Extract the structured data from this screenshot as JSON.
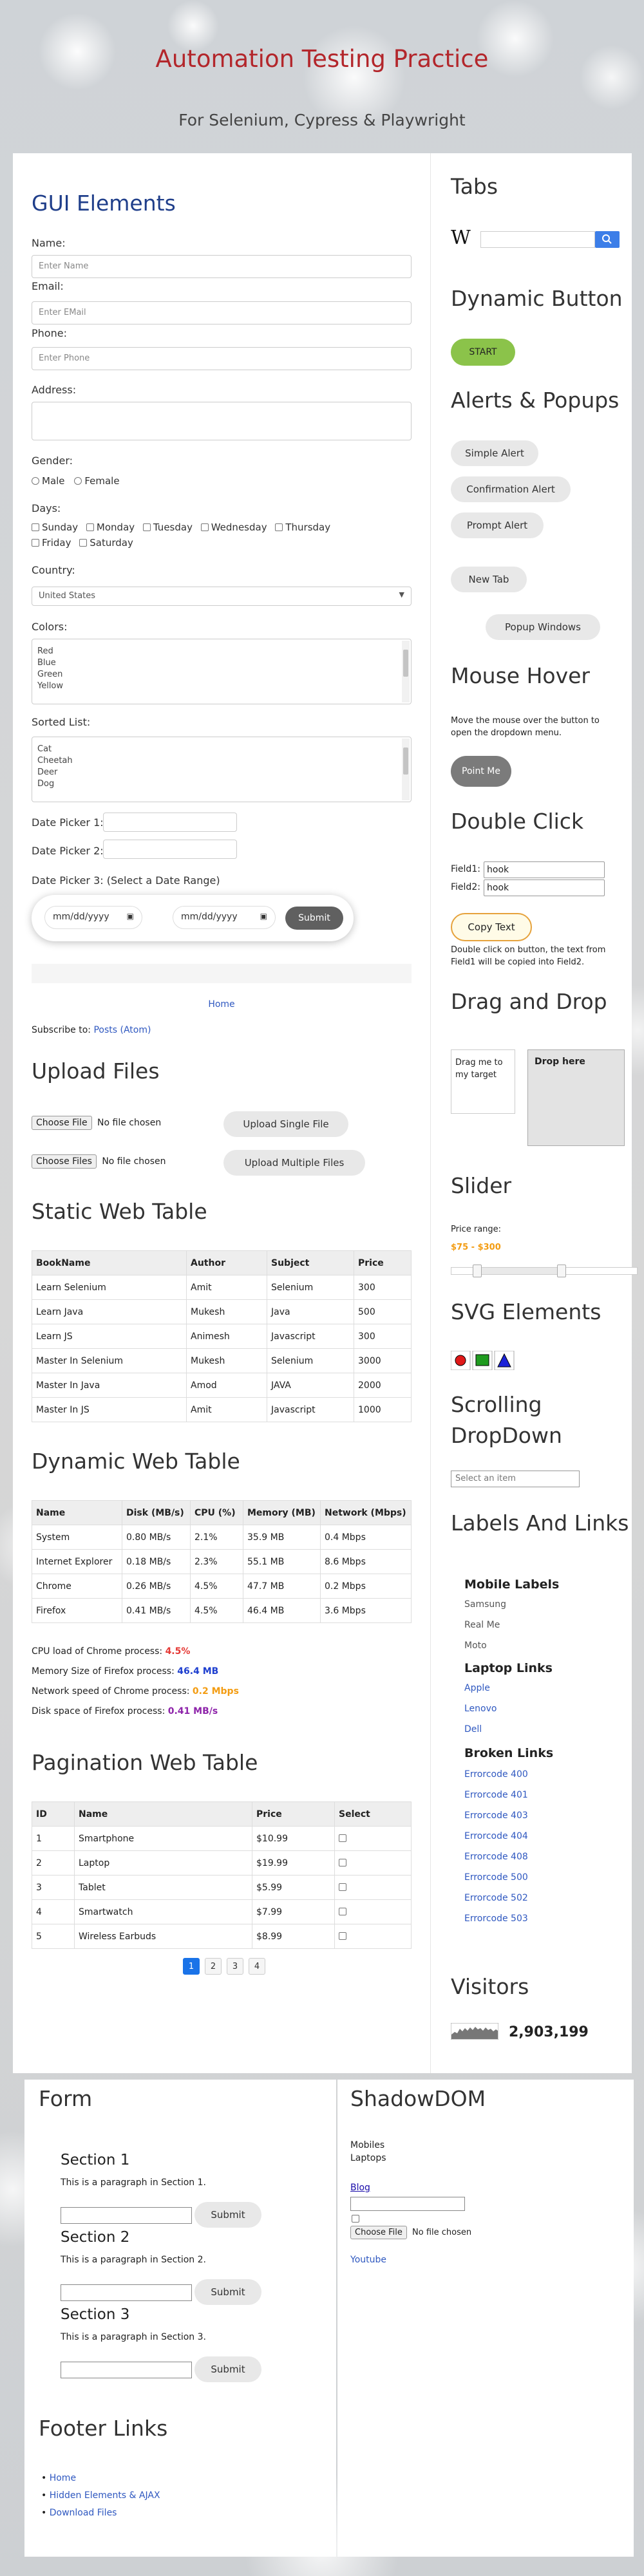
{
  "header": {
    "title": "Automation Testing Practice",
    "subtitle": "For Selenium, Cypress & Playwright"
  },
  "gui": {
    "title": "GUI Elements",
    "name_label": "Name:",
    "name_placeholder": "Enter Name",
    "email_label": "Email:",
    "email_placeholder": "Enter EMail",
    "phone_label": "Phone:",
    "phone_placeholder": "Enter Phone",
    "address_label": "Address:",
    "gender_label": "Gender:",
    "gender_options": [
      "Male",
      "Female"
    ],
    "days_label": "Days:",
    "days": [
      "Sunday",
      "Monday",
      "Tuesday",
      "Wednesday",
      "Thursday",
      "Friday",
      "Saturday"
    ],
    "country_label": "Country:",
    "country_value": "United States",
    "colors_label": "Colors:",
    "colors": [
      "Red",
      "Blue",
      "Green",
      "Yellow"
    ],
    "sorted_label": "Sorted List:",
    "sorted": [
      "Cat",
      "Cheetah",
      "Deer",
      "Dog"
    ],
    "dp1_label": "Date Picker 1:",
    "dp2_label": "Date Picker 2:",
    "dp3_label": "Date Picker 3: (Select a Date Range)",
    "date_placeholder": "mm/dd/yyyy",
    "submit": "Submit"
  },
  "blog": {
    "home": "Home",
    "subscribe_prefix": "Subscribe to: ",
    "subscribe_link": "Posts (Atom)"
  },
  "upload": {
    "title": "Upload Files",
    "choose_file": "Choose File",
    "choose_files": "Choose Files",
    "no_file": "No file chosen",
    "single_btn": "Upload Single File",
    "multi_btn": "Upload Multiple Files"
  },
  "static_table": {
    "title": "Static Web Table",
    "headers": [
      "BookName",
      "Author",
      "Subject",
      "Price"
    ],
    "rows": [
      [
        "Learn Selenium",
        "Amit",
        "Selenium",
        "300"
      ],
      [
        "Learn Java",
        "Mukesh",
        "Java",
        "500"
      ],
      [
        "Learn JS",
        "Animesh",
        "Javascript",
        "300"
      ],
      [
        "Master In Selenium",
        "Mukesh",
        "Selenium",
        "3000"
      ],
      [
        "Master In Java",
        "Amod",
        "JAVA",
        "2000"
      ],
      [
        "Master In JS",
        "Amit",
        "Javascript",
        "1000"
      ]
    ]
  },
  "dynamic_table": {
    "title": "Dynamic Web Table",
    "headers": [
      "Name",
      "Disk (MB/s)",
      "CPU (%)",
      "Memory (MB)",
      "Network (Mbps)"
    ],
    "rows": [
      [
        "System",
        "0.80 MB/s",
        "2.1%",
        "35.9 MB",
        "0.4 Mbps"
      ],
      [
        "Internet Explorer",
        "0.18 MB/s",
        "2.3%",
        "55.1 MB",
        "8.6 Mbps"
      ],
      [
        "Chrome",
        "0.26 MB/s",
        "4.5%",
        "47.7 MB",
        "0.2 Mbps"
      ],
      [
        "Firefox",
        "0.41 MB/s",
        "4.5%",
        "46.4 MB",
        "3.6 Mbps"
      ]
    ],
    "stats": [
      {
        "label": "CPU load of Chrome process: ",
        "value": "4.5%",
        "color": "#e53935"
      },
      {
        "label": "Memory Size of Firefox process: ",
        "value": "46.4 MB",
        "color": "#1e3fcf"
      },
      {
        "label": "Network speed of Chrome process: ",
        "value": "0.2 Mbps",
        "color": "#f39c12"
      },
      {
        "label": "Disk space of Firefox process: ",
        "value": "0.41 MB/s",
        "color": "#8e24aa"
      }
    ]
  },
  "pagination": {
    "title": "Pagination Web Table",
    "headers": [
      "ID",
      "Name",
      "Price",
      "Select"
    ],
    "rows": [
      [
        "1",
        "Smartphone",
        "$10.99"
      ],
      [
        "2",
        "Laptop",
        "$19.99"
      ],
      [
        "3",
        "Tablet",
        "$5.99"
      ],
      [
        "4",
        "Smartwatch",
        "$7.99"
      ],
      [
        "5",
        "Wireless Earbuds",
        "$8.99"
      ]
    ],
    "pages": [
      "1",
      "2",
      "3",
      "4"
    ],
    "active_page": "1"
  },
  "tabs": {
    "title": "Tabs",
    "wiki_logo": "W",
    "search_icon": "search-icon"
  },
  "dynamic_button": {
    "title": "Dynamic Button",
    "start": "START",
    "color": "#8bc34a"
  },
  "alerts": {
    "title": "Alerts & Popups",
    "simple": "Simple Alert",
    "confirm": "Confirmation Alert",
    "prompt": "Prompt Alert",
    "new_tab": "New Tab",
    "popup": "Popup Windows"
  },
  "mouse_hover": {
    "title": "Mouse Hover",
    "desc": "Move the mouse over the button to open the dropdown menu.",
    "button": "Point Me"
  },
  "double_click": {
    "title": "Double Click",
    "field1_label": "Field1:",
    "field1_value": "hook",
    "field2_label": "Field2:",
    "field2_value": "hook",
    "button": "Copy Text",
    "desc": "Double click on button, the text from Field1 will be copied into Field2."
  },
  "drag_drop": {
    "title": "Drag and Drop",
    "drag_text": "Drag me to my target",
    "drop_text": "Drop here"
  },
  "slider": {
    "title": "Slider",
    "range_label": "Price range:",
    "range_value": "$75 - $300"
  },
  "svg_elements": {
    "title": "SVG Elements"
  },
  "scrolling_dropdown": {
    "title": "Scrolling DropDown",
    "placeholder": "Select an item"
  },
  "labels_links": {
    "title": "Labels And Links",
    "mobile_title": "Mobile Labels",
    "mobiles": [
      "Samsung",
      "Real Me",
      "Moto"
    ],
    "laptop_title": "Laptop Links",
    "laptops": [
      "Apple",
      "Lenovo",
      "Dell"
    ],
    "broken_title": "Broken Links",
    "broken": [
      "Errorcode 400",
      "Errorcode 401",
      "Errorcode 403",
      "Errorcode 404",
      "Errorcode 408",
      "Errorcode 500",
      "Errorcode 502",
      "Errorcode 503"
    ]
  },
  "visitors": {
    "title": "Visitors",
    "count": "2,903,199"
  },
  "form": {
    "title": "Form",
    "sections": [
      {
        "title": "Section 1",
        "text": "This is a paragraph in Section 1."
      },
      {
        "title": "Section 2",
        "text": "This is a paragraph in Section 2."
      },
      {
        "title": "Section 3",
        "text": "This is a paragraph in Section 3."
      }
    ],
    "submit": "Submit"
  },
  "shadow": {
    "title": "ShadowDOM",
    "mobiles": "Mobiles",
    "laptops": "Laptops",
    "blog": "Blog",
    "choose_file": "Choose File",
    "no_file": "No file chosen",
    "youtube": "Youtube"
  },
  "footer_links": {
    "title": "Footer Links",
    "links": [
      "Home",
      "Hidden Elements & AJAX",
      "Download Files"
    ]
  }
}
